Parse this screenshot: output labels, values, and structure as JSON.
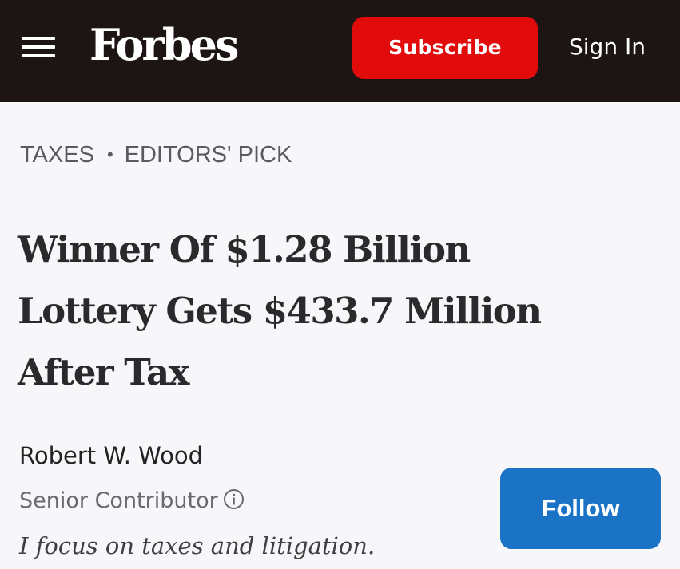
{
  "header": {
    "menu_icon": "hamburger-menu-icon",
    "logo": "Forbes",
    "subscribe_label": "Subscribe",
    "signin_label": "Sign In",
    "background_color": "#1d1414",
    "subscribe_color": "#e10b0b"
  },
  "article": {
    "breadcrumb": {
      "category": "TAXES",
      "separator": "•",
      "tag": "EDITORS' PICK"
    },
    "headline_lines": [
      "Winner Of $1.28 Billion",
      "Lottery Gets $433.7 Million",
      "After Tax"
    ],
    "author": {
      "name": "Robert W. Wood",
      "role": "Senior Contributor",
      "info_icon": "info-circle-icon",
      "bio": "I focus on taxes and litigation.",
      "follow_label": "Follow",
      "follow_color": "#1a73c4"
    }
  }
}
